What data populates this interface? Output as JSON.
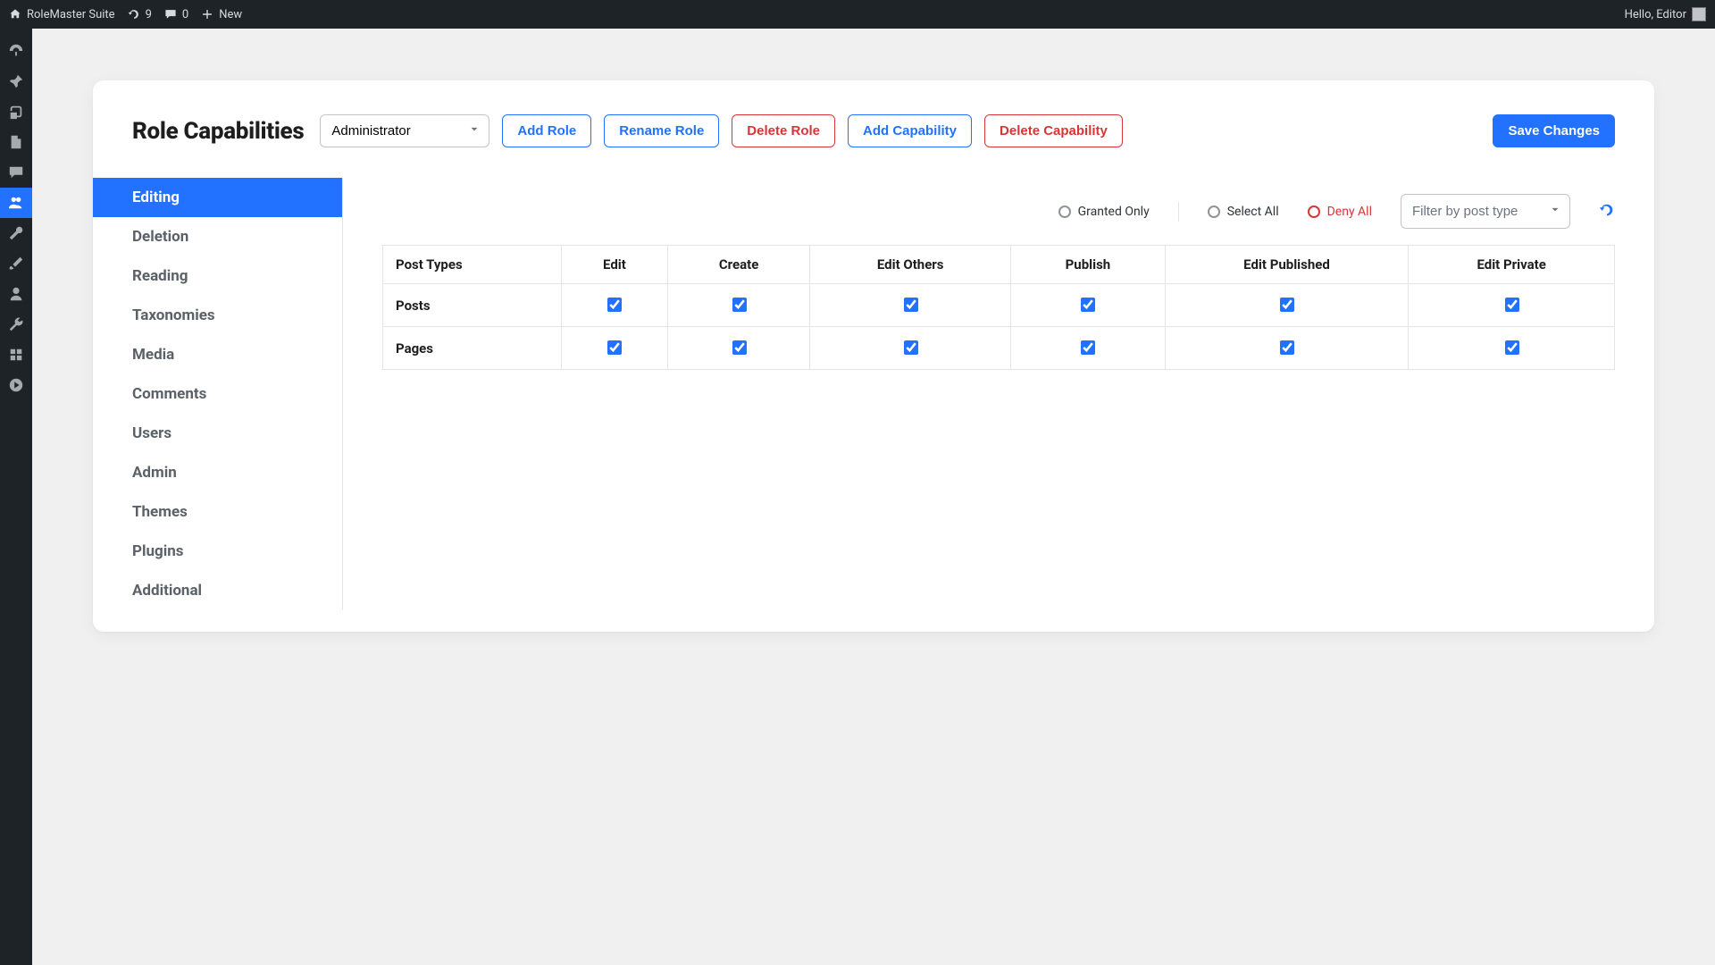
{
  "adminbar": {
    "site_name": "RoleMaster Suite",
    "updates": "9",
    "comments": "0",
    "new_label": "New",
    "greeting": "Hello, Editor"
  },
  "sidebar": {
    "items": [
      {
        "icon": "dashboard"
      },
      {
        "icon": "pin"
      },
      {
        "icon": "media"
      },
      {
        "icon": "page"
      },
      {
        "icon": "comment"
      },
      {
        "icon": "users",
        "current": true
      },
      {
        "icon": "tool"
      },
      {
        "icon": "brush"
      },
      {
        "icon": "profile"
      },
      {
        "icon": "wrench"
      },
      {
        "icon": "plugin"
      },
      {
        "icon": "play"
      }
    ]
  },
  "header": {
    "title": "Role Capabilities",
    "role_selected": "Administrator",
    "add_role": "Add Role",
    "rename_role": "Rename Role",
    "delete_role": "Delete Role",
    "add_cap": "Add Capability",
    "delete_cap": "Delete Capability",
    "save": "Save Changes"
  },
  "tabs": {
    "items": [
      {
        "label": "Editing",
        "active": true
      },
      {
        "label": "Deletion"
      },
      {
        "label": "Reading"
      },
      {
        "label": "Taxonomies"
      },
      {
        "label": "Media"
      },
      {
        "label": "Comments"
      },
      {
        "label": "Users"
      },
      {
        "label": "Admin"
      },
      {
        "label": "Themes"
      },
      {
        "label": "Plugins"
      },
      {
        "label": "Additional"
      }
    ]
  },
  "filters": {
    "granted_only": "Granted Only",
    "select_all": "Select All",
    "deny_all": "Deny All",
    "post_type_placeholder": "Filter by post type"
  },
  "table": {
    "columns": [
      "Post Types",
      "Edit",
      "Create",
      "Edit Others",
      "Publish",
      "Edit Published",
      "Edit Private"
    ],
    "rows": [
      {
        "label": "Posts",
        "caps": [
          true,
          true,
          true,
          true,
          true,
          true
        ]
      },
      {
        "label": "Pages",
        "caps": [
          true,
          true,
          true,
          true,
          true,
          true
        ]
      }
    ]
  }
}
